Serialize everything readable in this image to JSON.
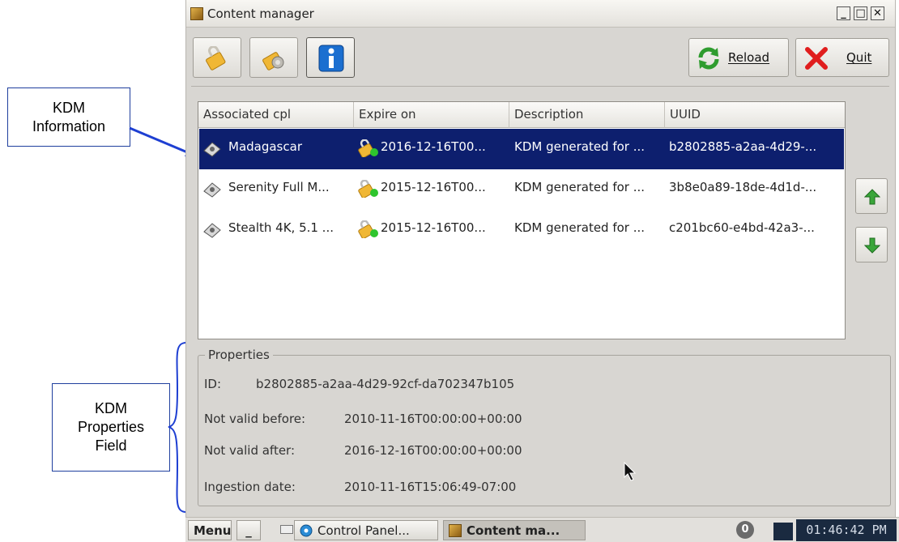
{
  "annotations": {
    "kdm_info_label": "KDM\nInformation",
    "kdm_props_label": "KDM\nProperties\nField"
  },
  "window": {
    "title": "Content manager",
    "min_glyph": "_",
    "max_glyph": "□",
    "close_glyph": "✕"
  },
  "toolbar": {
    "reload_label": "Reload",
    "quit_label": "Quit"
  },
  "table": {
    "columns": [
      "Associated cpl",
      "Expire on",
      "Description",
      "UUID"
    ],
    "rows": [
      {
        "cpl": "Madagascar",
        "expire": "2016-12-16T00...",
        "description": "KDM generated for ...",
        "uuid": "b2802885-a2aa-4d29-...",
        "selected": true
      },
      {
        "cpl": "Serenity Full M...",
        "expire": "2015-12-16T00...",
        "description": "KDM generated for ...",
        "uuid": "3b8e0a89-18de-4d1d-...",
        "selected": false
      },
      {
        "cpl": "Stealth 4K, 5.1 ...",
        "expire": "2015-12-16T00...",
        "description": "KDM generated for ...",
        "uuid": "c201bc60-e4bd-42a3-...",
        "selected": false
      }
    ]
  },
  "properties": {
    "legend": "Properties",
    "id_label": "ID:",
    "id_value": "b2802885-a2aa-4d29-92cf-da702347b105",
    "not_before_label": "Not valid before:",
    "not_before_value": "2010-11-16T00:00:00+00:00",
    "not_after_label": "Not valid after:",
    "not_after_value": "2016-12-16T00:00:00+00:00",
    "ingestion_label": "Ingestion date:",
    "ingestion_value": "2010-11-16T15:06:49-07:00"
  },
  "taskbar": {
    "menu_label": "Menu",
    "minimize_label": "_",
    "control_panel_label": "Control Panel...",
    "content_manager_label": "Content ma...",
    "badge_count": "0",
    "clock": "01:46:42 PM"
  },
  "colors": {
    "selection": "#0d1f6e",
    "annotation_border": "#1f3f9e",
    "arrow_up": "#3aa63a",
    "arrow_down": "#3aa63a",
    "quit_x": "#e01d1d"
  }
}
